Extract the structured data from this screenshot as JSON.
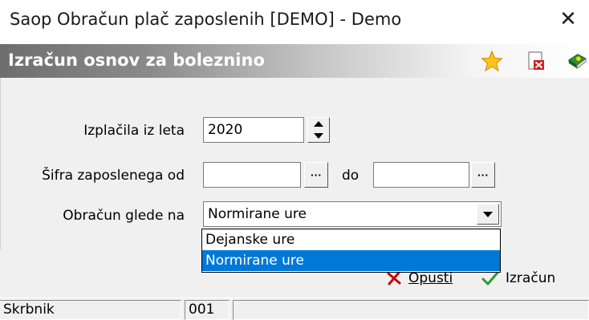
{
  "window": {
    "title": "Saop Obračun plač zaposlenih [DEMO] - Demo",
    "close_glyph": "✕"
  },
  "header": {
    "title": "Izračun osnov za boleznino",
    "icons": [
      "star-icon",
      "report-icon",
      "help-book-icon"
    ]
  },
  "form": {
    "year_label": "Izplačila iz leta",
    "year_value": "2020",
    "employee_label": "Šifra zaposlenega od",
    "employee_from_value": "",
    "to_label": "do",
    "employee_to_value": "",
    "browse_glyph": "···",
    "calc_basis_label": "Obračun glede na",
    "calc_basis_value": "Normirane ure"
  },
  "dropdown": {
    "options": [
      "Dejanske ure",
      "Normirane ure"
    ],
    "selected": "Normirane ure"
  },
  "actions": {
    "cancel_label": "Opusti",
    "calculate_label": "Izračun"
  },
  "status": {
    "left": "Skrbnik",
    "code": "001",
    "right": ""
  },
  "colors": {
    "selection": "#0078d7",
    "cancel": "#cc0000",
    "confirm": "#2e9a2e"
  }
}
